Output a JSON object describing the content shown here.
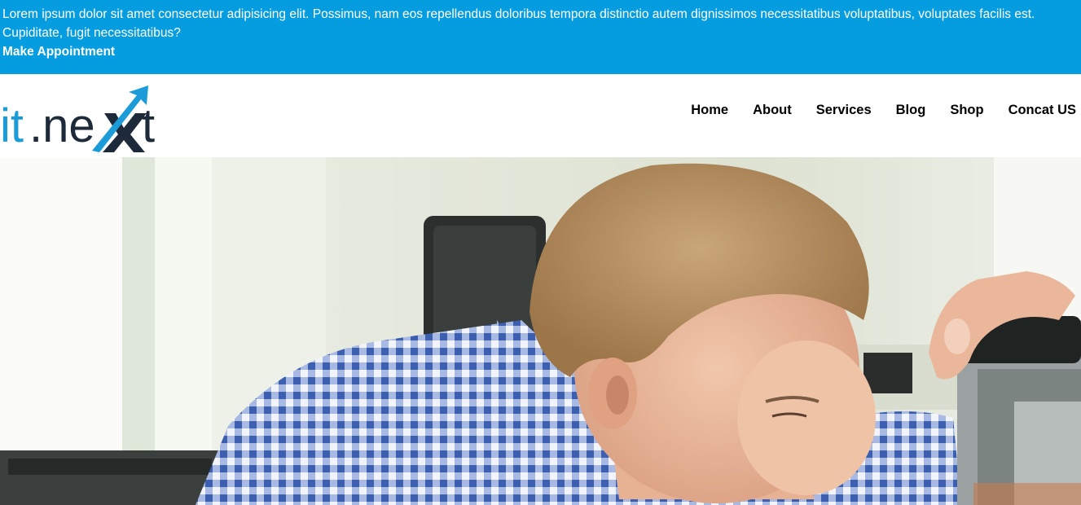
{
  "topbar": {
    "text": "Lorem ipsum dolor sit amet consectetur adipisicing elit. Possimus, nam eos repellendus doloribus tempora distinctio autem dignissimos necessitatibus voluptatibus, voluptates facilis est. Cupiditate, fugit necessitatibus?",
    "cta_label": "Make Appointment",
    "background": "#069de0"
  },
  "logo": {
    "text_it": "it",
    "text_next": ".ne",
    "text_t": "t",
    "primary_color": "#1b9bd7",
    "dark_color": "#1d2a3a"
  },
  "nav": {
    "items": [
      {
        "label": "Home"
      },
      {
        "label": "About"
      },
      {
        "label": "Services"
      },
      {
        "label": "Blog"
      },
      {
        "label": "Shop"
      },
      {
        "label": "Concat US"
      }
    ]
  },
  "hero": {
    "image": "photo-icon"
  }
}
